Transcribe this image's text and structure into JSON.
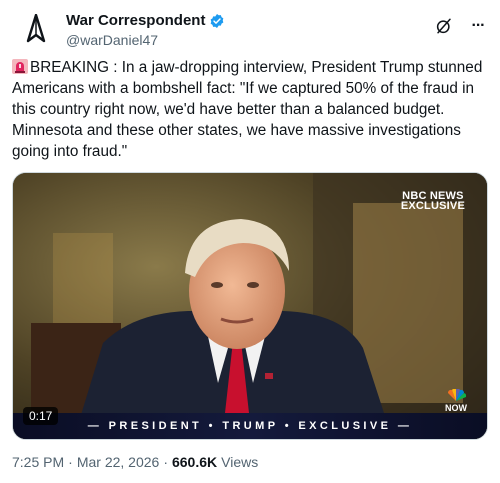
{
  "author": {
    "display_name": "War Correspondent",
    "handle": "@warDaniel47",
    "verified": true,
    "avatar_icon": "compass-logo-icon"
  },
  "header_actions": {
    "grok_icon": "grok-icon",
    "more_icon": "more-icon",
    "more_label": "···"
  },
  "tweet": {
    "badge_icon": "siren-icon",
    "text": "BREAKING : In a jaw-dropping interview, President Trump stunned Americans with a bombshell fact: \"If we captured 50% of the fraud in this country right now, we'd have better than a balanced budget. Minnesota and these other states, we have massive investigations going into fraud.\""
  },
  "media": {
    "type": "video",
    "duration": "0:17",
    "network_logo_line1": "NBC NEWS",
    "network_logo_line2": "EXCLUSIVE",
    "lower_third": "— PRESIDENT • TRUMP • EXCLUSIVE —",
    "corner_logo": "NOW"
  },
  "meta": {
    "time": "7:25 PM",
    "separator": "·",
    "date": "Mar 22, 2026",
    "views_count": "660.6K",
    "views_label": "Views"
  },
  "colors": {
    "text": "#0f1419",
    "secondary": "#536471",
    "verified_blue": "#1d9bf0"
  }
}
